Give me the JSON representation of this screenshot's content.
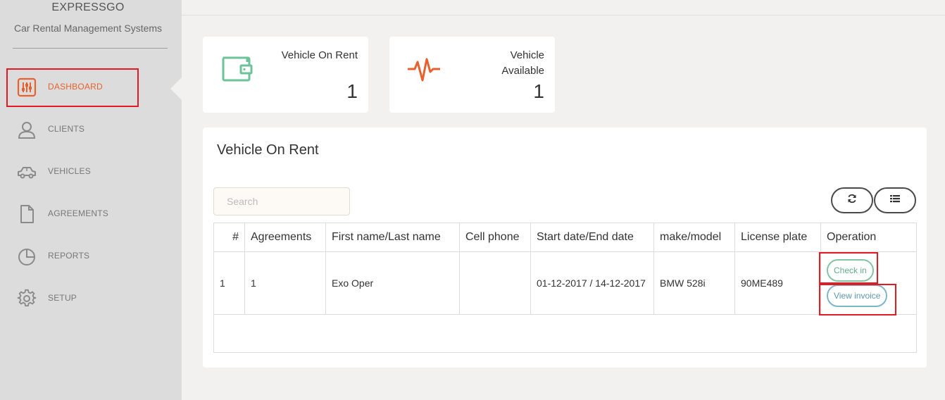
{
  "brand": {
    "title": "EXPRESSGO",
    "subtitle": "Car Rental Management Systems"
  },
  "nav": [
    {
      "label": "DASHBOARD",
      "icon": "sliders-icon",
      "active": true
    },
    {
      "label": "CLIENTS",
      "icon": "user-icon"
    },
    {
      "label": "VEHICLES",
      "icon": "car-icon"
    },
    {
      "label": "AGREEMENTS",
      "icon": "document-icon"
    },
    {
      "label": "REPORTS",
      "icon": "pie-chart-icon"
    },
    {
      "label": "SETUP",
      "icon": "gear-icon"
    }
  ],
  "stats": [
    {
      "label": "Vehicle On Rent",
      "value": "1",
      "icon": "wallet-icon",
      "color": "#6cc39a"
    },
    {
      "label": "Vehicle Available",
      "value": "1",
      "icon": "pulse-icon",
      "color": "#e8612c"
    }
  ],
  "panel": {
    "title": "Vehicle On Rent",
    "search_placeholder": "Search",
    "columns": [
      "#",
      "Agreements",
      "First name/Last name",
      "Cell phone",
      "Start date/End date",
      "make/model",
      "License plate",
      "Operation"
    ],
    "rows": [
      {
        "num": "1",
        "agreement": "1",
        "name": "Exo Oper",
        "phone": "",
        "dates": "01-12-2017 / 14-12-2017",
        "model": "BMW 528i",
        "plate": "90ME489",
        "actions": [
          "Check in",
          "View invoice"
        ]
      }
    ]
  },
  "colors": {
    "accent": "#e8612c",
    "green": "#6cc39a",
    "highlight": "#e01b24"
  }
}
